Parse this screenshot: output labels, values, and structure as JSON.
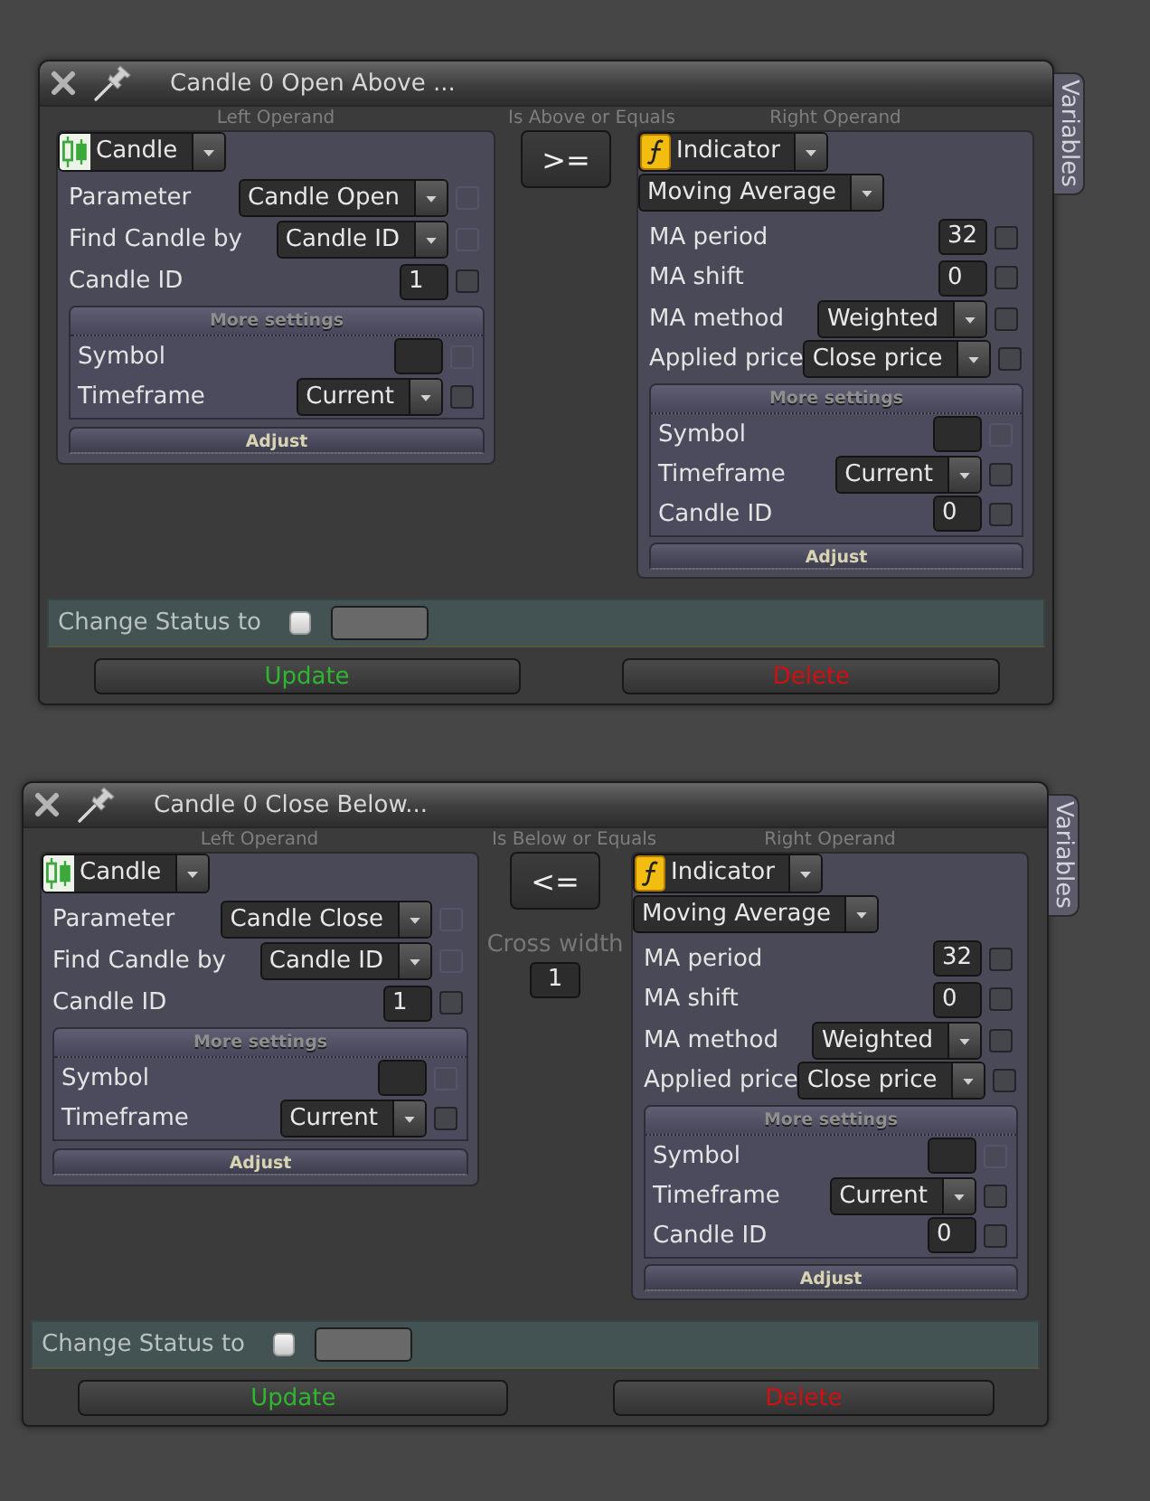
{
  "windows": [
    {
      "title": "Candle 0 Open Above ...",
      "side_tab": "Variables",
      "left_operand": {
        "heading": "Left Operand",
        "type": {
          "label": "Candle",
          "kind": "candle"
        },
        "fields": [
          {
            "label": "Parameter",
            "kind": "dropdown",
            "value": "Candle Open",
            "checkbox": {
              "checked": false,
              "disabled": true
            }
          },
          {
            "label": "Find Candle by",
            "kind": "dropdown",
            "value": "Candle ID",
            "checkbox": {
              "checked": false,
              "disabled": true
            }
          },
          {
            "label": "Candle ID",
            "kind": "number",
            "value": "1",
            "checkbox": {
              "checked": false,
              "disabled": false
            }
          }
        ],
        "more_settings": {
          "heading": "More settings",
          "fields": [
            {
              "label": "Symbol",
              "kind": "text",
              "checkbox": {
                "checked": false,
                "disabled": true
              }
            },
            {
              "label": "Timeframe",
              "kind": "dropdown",
              "value": "Current",
              "checkbox": {
                "checked": false,
                "disabled": false
              }
            }
          ]
        },
        "adjust": "Adjust"
      },
      "comparison": {
        "heading": "Is Above or Equals",
        "operator": ">="
      },
      "right_operand": {
        "heading": "Right Operand",
        "type": {
          "label": "Indicator",
          "kind": "indicator"
        },
        "indicator": "Moving Average",
        "fields": [
          {
            "label": "MA period",
            "kind": "number",
            "value": "32",
            "checkbox": {
              "checked": false,
              "disabled": false
            }
          },
          {
            "label": "MA shift",
            "kind": "number",
            "value": "0",
            "checkbox": {
              "checked": false,
              "disabled": false
            }
          },
          {
            "label": "MA method",
            "kind": "dropdown",
            "value": "Weighted",
            "checkbox": {
              "checked": false,
              "disabled": false
            }
          },
          {
            "label": "Applied price",
            "kind": "dropdown",
            "value": "Close price",
            "checkbox": {
              "checked": false,
              "disabled": false
            }
          }
        ],
        "more_settings": {
          "heading": "More settings",
          "fields": [
            {
              "label": "Symbol",
              "kind": "text",
              "checkbox": {
                "checked": false,
                "disabled": true
              }
            },
            {
              "label": "Timeframe",
              "kind": "dropdown",
              "value": "Current",
              "checkbox": {
                "checked": false,
                "disabled": false
              }
            },
            {
              "label": "Candle ID",
              "kind": "number",
              "value": "0",
              "checkbox": {
                "checked": false,
                "disabled": false
              }
            }
          ]
        },
        "adjust": "Adjust"
      },
      "change_status": {
        "label": "Change Status to",
        "checked": false
      },
      "buttons": [
        {
          "label": "Update",
          "kind": "update"
        },
        {
          "label": "Delete",
          "kind": "delete"
        }
      ]
    },
    {
      "title": "Candle 0 Close Below...",
      "side_tab": "Variables",
      "left_operand": {
        "heading": "Left Operand",
        "type": {
          "label": "Candle",
          "kind": "candle"
        },
        "fields": [
          {
            "label": "Parameter",
            "kind": "dropdown",
            "value": "Candle Close",
            "checkbox": {
              "checked": false,
              "disabled": true
            }
          },
          {
            "label": "Find Candle by",
            "kind": "dropdown",
            "value": "Candle ID",
            "checkbox": {
              "checked": false,
              "disabled": true
            }
          },
          {
            "label": "Candle ID",
            "kind": "number",
            "value": "1",
            "checkbox": {
              "checked": false,
              "disabled": false
            }
          }
        ],
        "more_settings": {
          "heading": "More settings",
          "fields": [
            {
              "label": "Symbol",
              "kind": "text",
              "checkbox": {
                "checked": false,
                "disabled": true
              }
            },
            {
              "label": "Timeframe",
              "kind": "dropdown",
              "value": "Current",
              "checkbox": {
                "checked": false,
                "disabled": false
              }
            }
          ]
        },
        "adjust": "Adjust"
      },
      "comparison": {
        "heading": "Is Below or Equals",
        "operator": "<=",
        "cross_width": {
          "label": "Cross width",
          "value": "1"
        }
      },
      "right_operand": {
        "heading": "Right Operand",
        "type": {
          "label": "Indicator",
          "kind": "indicator"
        },
        "indicator": "Moving Average",
        "fields": [
          {
            "label": "MA period",
            "kind": "number",
            "value": "32",
            "checkbox": {
              "checked": false,
              "disabled": false
            }
          },
          {
            "label": "MA shift",
            "kind": "number",
            "value": "0",
            "checkbox": {
              "checked": false,
              "disabled": false
            }
          },
          {
            "label": "MA method",
            "kind": "dropdown",
            "value": "Weighted",
            "checkbox": {
              "checked": false,
              "disabled": false
            }
          },
          {
            "label": "Applied price",
            "kind": "dropdown",
            "value": "Close price",
            "checkbox": {
              "checked": false,
              "disabled": false
            }
          }
        ],
        "more_settings": {
          "heading": "More settings",
          "fields": [
            {
              "label": "Symbol",
              "kind": "text",
              "checkbox": {
                "checked": false,
                "disabled": true
              }
            },
            {
              "label": "Timeframe",
              "kind": "dropdown",
              "value": "Current",
              "checkbox": {
                "checked": false,
                "disabled": false
              }
            },
            {
              "label": "Candle ID",
              "kind": "number",
              "value": "0",
              "checkbox": {
                "checked": false,
                "disabled": false
              }
            }
          ]
        },
        "adjust": "Adjust"
      },
      "change_status": {
        "label": "Change Status to",
        "checked": false
      },
      "buttons": [
        {
          "label": "Update",
          "kind": "update"
        },
        {
          "label": "Delete",
          "kind": "delete"
        }
      ]
    }
  ]
}
